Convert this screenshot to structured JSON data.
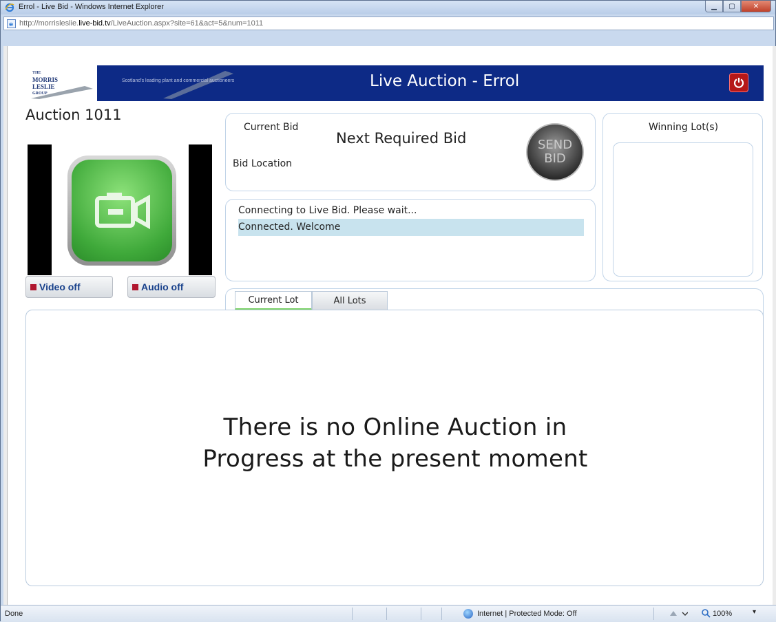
{
  "browser": {
    "title": "Errol - Live Bid - Windows Internet Explorer",
    "url_prefix": "http://morrisleslie.",
    "url_domain": "live-bid.tv",
    "url_path": "/LiveAuction.aspx?site=61&act=5&num=1011",
    "status_left": "Done",
    "zone": "Internet | Protected Mode: Off",
    "zoom": "100%"
  },
  "header": {
    "logo_lines": [
      "THE",
      "MORRIS",
      "LESLIE",
      "GROUP"
    ],
    "tagline": "Scotland's leading plant and commercial auctioneers",
    "title": "Live Auction - Errol",
    "power_icon": "power-icon"
  },
  "auction": {
    "title": "Auction 1011"
  },
  "media": {
    "video_label": "Video off",
    "audio_label": "Audio off"
  },
  "bid": {
    "current_bid_label": "Current Bid",
    "next_required_label": "Next Required Bid",
    "bid_location_label": "Bid Location",
    "send_line1": "SEND",
    "send_line2": "BID"
  },
  "messages": {
    "lines": [
      "Connecting to Live Bid. Please wait...",
      "Connected. Welcome"
    ]
  },
  "winning": {
    "title": "Winning Lot(s)"
  },
  "tabs": {
    "current": "Current Lot",
    "all": "All Lots"
  },
  "content": {
    "line1": "There is no Online Auction in",
    "line2": "Progress at the present moment"
  },
  "colors": {
    "banner": "#0d2a86",
    "accent_green": "#7ed36a",
    "message_highlight": "#c8e3ee",
    "power": "#b51818"
  }
}
